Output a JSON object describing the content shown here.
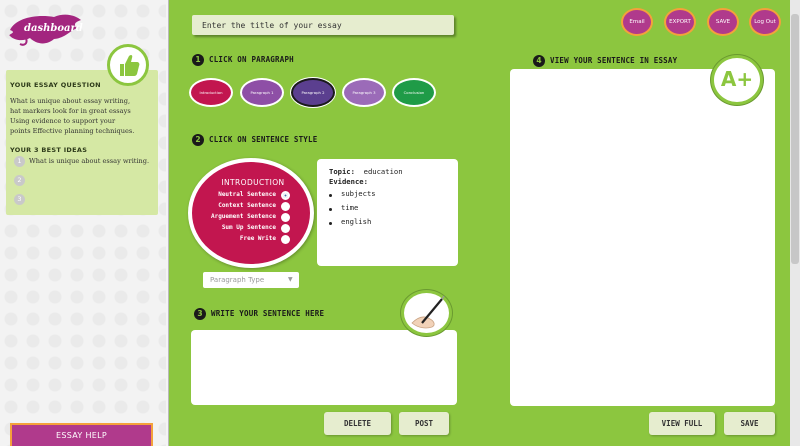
{
  "sidebar": {
    "logo": "dashboard",
    "question_heading": "YOUR ESSAY QUESTION",
    "question_lines": [
      "What is unique about essay writing,",
      "hat markers look for in great essays",
      "Using evidence to support your",
      "points  Effective planning techniques."
    ],
    "ideas_heading": "YOUR 3 BEST IDEAS",
    "ideas": [
      {
        "num": "1",
        "text": "What is unique about essay writing."
      },
      {
        "num": "2",
        "text": ""
      },
      {
        "num": "3",
        "text": ""
      }
    ],
    "help_button": "ESSAY HELP"
  },
  "header": {
    "title_placeholder": "Enter the title of your essay",
    "buttons": {
      "email": "Email",
      "export": "EXPORT",
      "save": "SAVE",
      "logout": "Log Out"
    }
  },
  "step1": {
    "num": "1",
    "label": "CLICK ON PARAGRAPH",
    "paragraphs": [
      {
        "label": "Introduction",
        "color": "#c2164f"
      },
      {
        "label": "Paragraph 1",
        "color": "#8e4fa6"
      },
      {
        "label": "Paragraph 2",
        "color": "#5b3f8f"
      },
      {
        "label": "Paragraph 3",
        "color": "#9b6bb8"
      },
      {
        "label": "Conclusion",
        "color": "#1f9b47"
      }
    ]
  },
  "step2": {
    "num": "2",
    "label": "CLICK ON SENTENCE STYLE",
    "circle_title": "INTRODUCTION",
    "styles": [
      "Neutral Sentence",
      "Context Sentence",
      "Arguement Sentence",
      "Sum Up Sentence",
      "Free Write"
    ],
    "selected_style": "Neutral Sentence",
    "dropdown_value": "Paragraph Type",
    "topic_label": "Topic:",
    "topic_value": "education",
    "evidence_label": "Evidence:",
    "evidence_items": [
      "subjects",
      "time",
      "english"
    ]
  },
  "step3": {
    "num": "3",
    "label": "WRITE YOUR SENTENCE HERE",
    "delete_label": "DELETE",
    "post_label": "POST"
  },
  "step4": {
    "num": "4",
    "label": "VIEW YOUR SENTENCE IN ESSAY",
    "badge": "A+",
    "view_full_label": "VIEW FULL",
    "save_label": "SAVE"
  },
  "colors": {
    "green": "#8cc63f",
    "magenta": "#b03a8c",
    "orange": "#f4a13b"
  }
}
